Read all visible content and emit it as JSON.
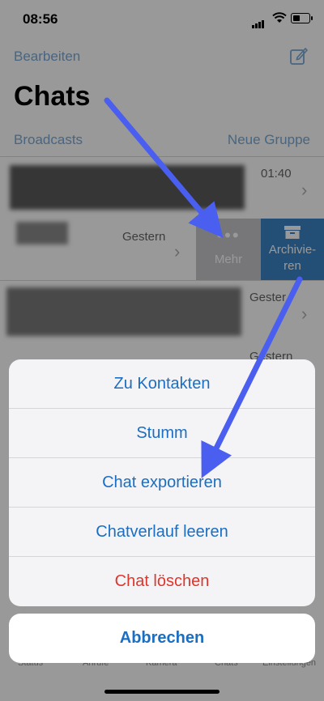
{
  "status_bar": {
    "time": "08:56"
  },
  "header": {
    "edit_label": "Bearbeiten",
    "title": "Chats",
    "broadcasts_label": "Broadcasts",
    "new_group_label": "Neue Gruppe"
  },
  "rows": [
    {
      "time": "01:40"
    },
    {
      "time": "Gestern"
    },
    {
      "time": "Gester"
    },
    {
      "time": "Gestern"
    }
  ],
  "swipe_actions": {
    "more_label": "Mehr",
    "archive_label_line1": "Archivie-",
    "archive_label_line2": "ren"
  },
  "tabbar": {
    "items": [
      "Status",
      "Anrufe",
      "Kamera",
      "Chats",
      "Einstellungen"
    ]
  },
  "action_sheet": {
    "items": [
      "Zu Kontakten",
      "Stumm",
      "Chat exportieren",
      "Chatverlauf leeren",
      "Chat löschen"
    ],
    "cancel_label": "Abbrechen"
  },
  "colors": {
    "accent": "#1b6ec2",
    "destructive": "#e0352c",
    "archive": "#3b82c4",
    "annotation_arrow": "#4a5ef0"
  },
  "icons": {
    "compose": "compose-icon",
    "more": "more-dots-icon",
    "archive": "archive-box-icon"
  }
}
